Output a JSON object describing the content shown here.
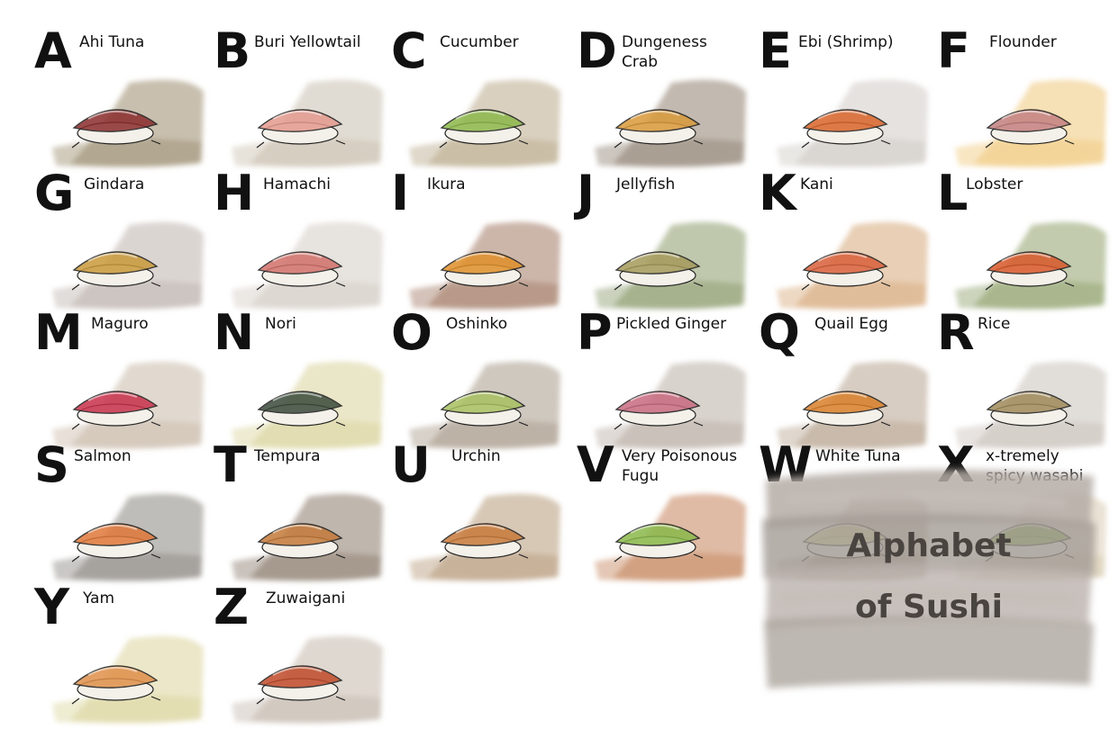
{
  "title": {
    "line1": "Alphabet",
    "line2": "of Sushi"
  },
  "items": [
    {
      "letter": "A",
      "name": "Ahi Tuna",
      "bg": "#9a8b6c",
      "food": "#8a2c2c"
    },
    {
      "letter": "B",
      "name": "Buri Yellowtail",
      "bg": "#c9bfae",
      "food": "#e49a8e"
    },
    {
      "letter": "C",
      "name": "Cucumber",
      "bg": "#b9a98a",
      "food": "#8cb84a"
    },
    {
      "letter": "D",
      "name": "Dungeness",
      "name2": "Crab",
      "bg": "#8f8070",
      "food": "#d99a3a"
    },
    {
      "letter": "E",
      "name": "Ebi (Shrimp)",
      "bg": "#cfcac4",
      "food": "#d9652a"
    },
    {
      "letter": "F",
      "name": "Flounder",
      "bg": "#efc77a",
      "food": "#c48080"
    },
    {
      "letter": "G",
      "name": "Gindara",
      "bg": "#bdb3ad",
      "food": "#c99a3a"
    },
    {
      "letter": "H",
      "name": "Hamachi",
      "bg": "#d4ccc4",
      "food": "#d2706a"
    },
    {
      "letter": "I",
      "name": "Ikura",
      "bg": "#a27a64",
      "food": "#e0902a"
    },
    {
      "letter": "J",
      "name": "Jellyfish",
      "bg": "#8a9a6a",
      "food": "#a59a5a"
    },
    {
      "letter": "K",
      "name": "Kani",
      "bg": "#d6a87a",
      "food": "#d9603a"
    },
    {
      "letter": "L",
      "name": "Lobster",
      "bg": "#8fa06a",
      "food": "#d8582a"
    },
    {
      "letter": "M",
      "name": "Maguro",
      "bg": "#c9b9a8",
      "food": "#c8304a"
    },
    {
      "letter": "N",
      "name": "Nori",
      "bg": "#d9d29a",
      "food": "#3a4a3a"
    },
    {
      "letter": "O",
      "name": "Oshinko",
      "bg": "#a89a8a",
      "food": "#a8c060"
    },
    {
      "letter": "P",
      "name": "Pickled Ginger",
      "bg": "#b9aea4",
      "food": "#c86a80"
    },
    {
      "letter": "Q",
      "name": "Quail Egg",
      "bg": "#b8a490",
      "food": "#d9802a"
    },
    {
      "letter": "R",
      "name": "Rice",
      "bg": "#c9c2ba",
      "food": "#a08a5a"
    },
    {
      "letter": "S",
      "name": "Salmon",
      "bg": "#8a8680",
      "food": "#e0783a"
    },
    {
      "letter": "T",
      "name": "Tempura",
      "bg": "#8a7a6a",
      "food": "#c47a3a"
    },
    {
      "letter": "U",
      "name": "Urchin",
      "bg": "#b69a7a",
      "food": "#c87a3a"
    },
    {
      "letter": "V",
      "name": "Very Poisonous",
      "name2": "Fugu",
      "bg": "#c4825a",
      "food": "#8ab84a"
    },
    {
      "letter": "W",
      "name": "White Tuna",
      "bg": "#a89a82",
      "food": "#d6d490"
    },
    {
      "letter": "X",
      "name": "x-tremely",
      "name2": "spicy wasabi",
      "bg": "#d8cab0",
      "food": "#7aa83a"
    },
    {
      "letter": "Y",
      "name": "Yam",
      "bg": "#dad49a",
      "food": "#e0904a"
    },
    {
      "letter": "Z",
      "name": "Zuwaigani",
      "bg": "#c4b8ac",
      "food": "#c04a2a"
    }
  ]
}
